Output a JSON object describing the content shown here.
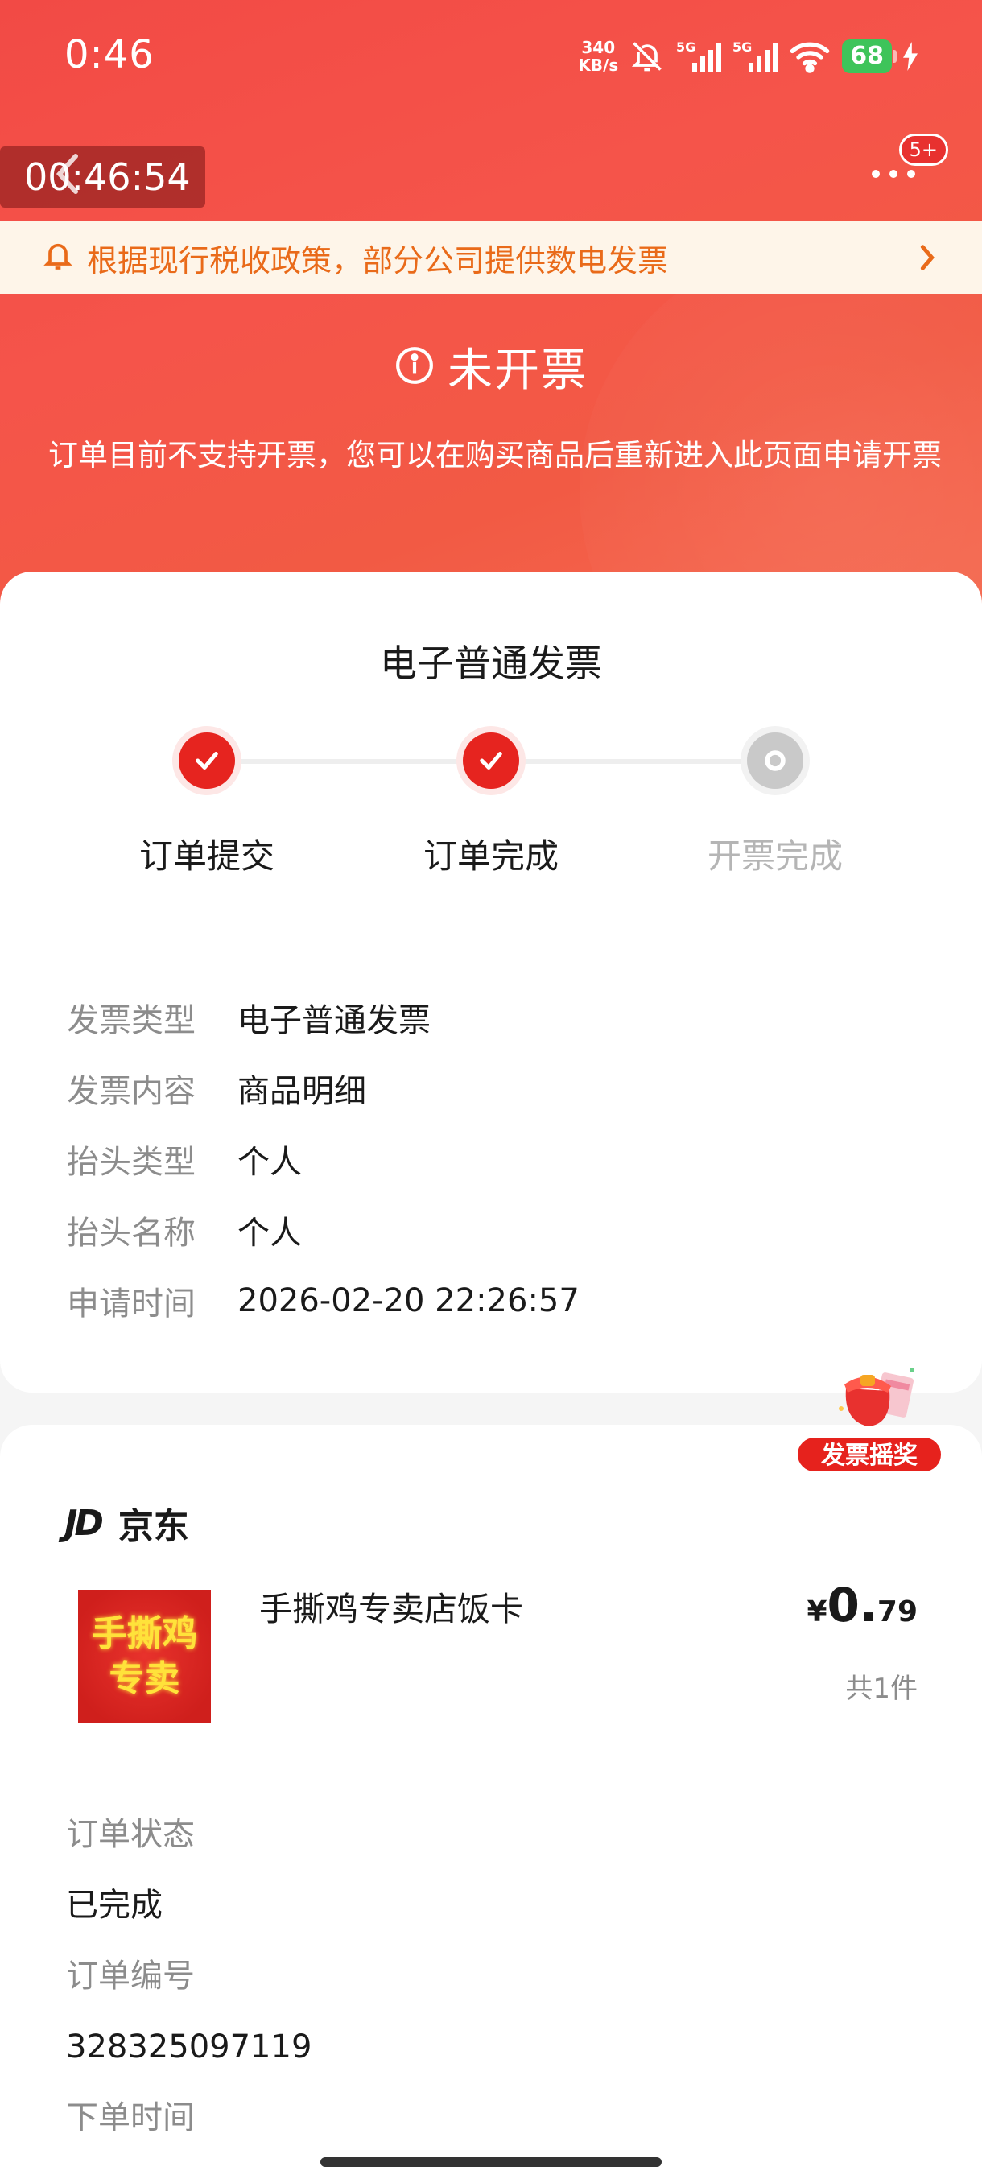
{
  "status_bar": {
    "time": "0:46",
    "net_speed_value": "340",
    "net_speed_unit": "KB/s",
    "battery": "68"
  },
  "nav": {
    "timer": "00:46:54",
    "badge": "5+"
  },
  "notice": {
    "text": "根据现行税收政策，部分公司提供数电发票"
  },
  "invoice_status": {
    "title": "未开票",
    "description": "订单目前不支持开票，您可以在购买商品后重新进入此页面申请开票"
  },
  "invoice_card": {
    "title": "电子普通发票",
    "steps": [
      {
        "label": "订单提交",
        "done": true
      },
      {
        "label": "订单完成",
        "done": true
      },
      {
        "label": "开票完成",
        "done": false
      }
    ],
    "rows": [
      {
        "label": "发票类型",
        "value": "电子普通发票"
      },
      {
        "label": "发票内容",
        "value": "商品明细"
      },
      {
        "label": "抬头类型",
        "value": "个人"
      },
      {
        "label": "抬头名称",
        "value": "个人"
      },
      {
        "label": "申请时间",
        "value": "2026-02-20 22:26:57"
      }
    ]
  },
  "lottery": {
    "label": "发票摇奖"
  },
  "order_card": {
    "shop_logo": "JD",
    "shop_name": "京东",
    "product": {
      "image_text_line1": "手撕鸡",
      "image_text_line2": "专卖",
      "name": "手撕鸡专卖店饭卡",
      "price_symbol": "¥",
      "price_int": "0.",
      "price_dec": "79",
      "quantity": "共1件"
    },
    "fields": [
      {
        "label": "订单状态",
        "value": "已完成"
      },
      {
        "label": "订单编号",
        "value": "328325097119"
      },
      {
        "label": "下单时间",
        "value": ""
      }
    ]
  },
  "colors": {
    "primary_red": "#e6241f",
    "notice_orange": "#e96a19",
    "notice_bg": "#fef5e9"
  }
}
